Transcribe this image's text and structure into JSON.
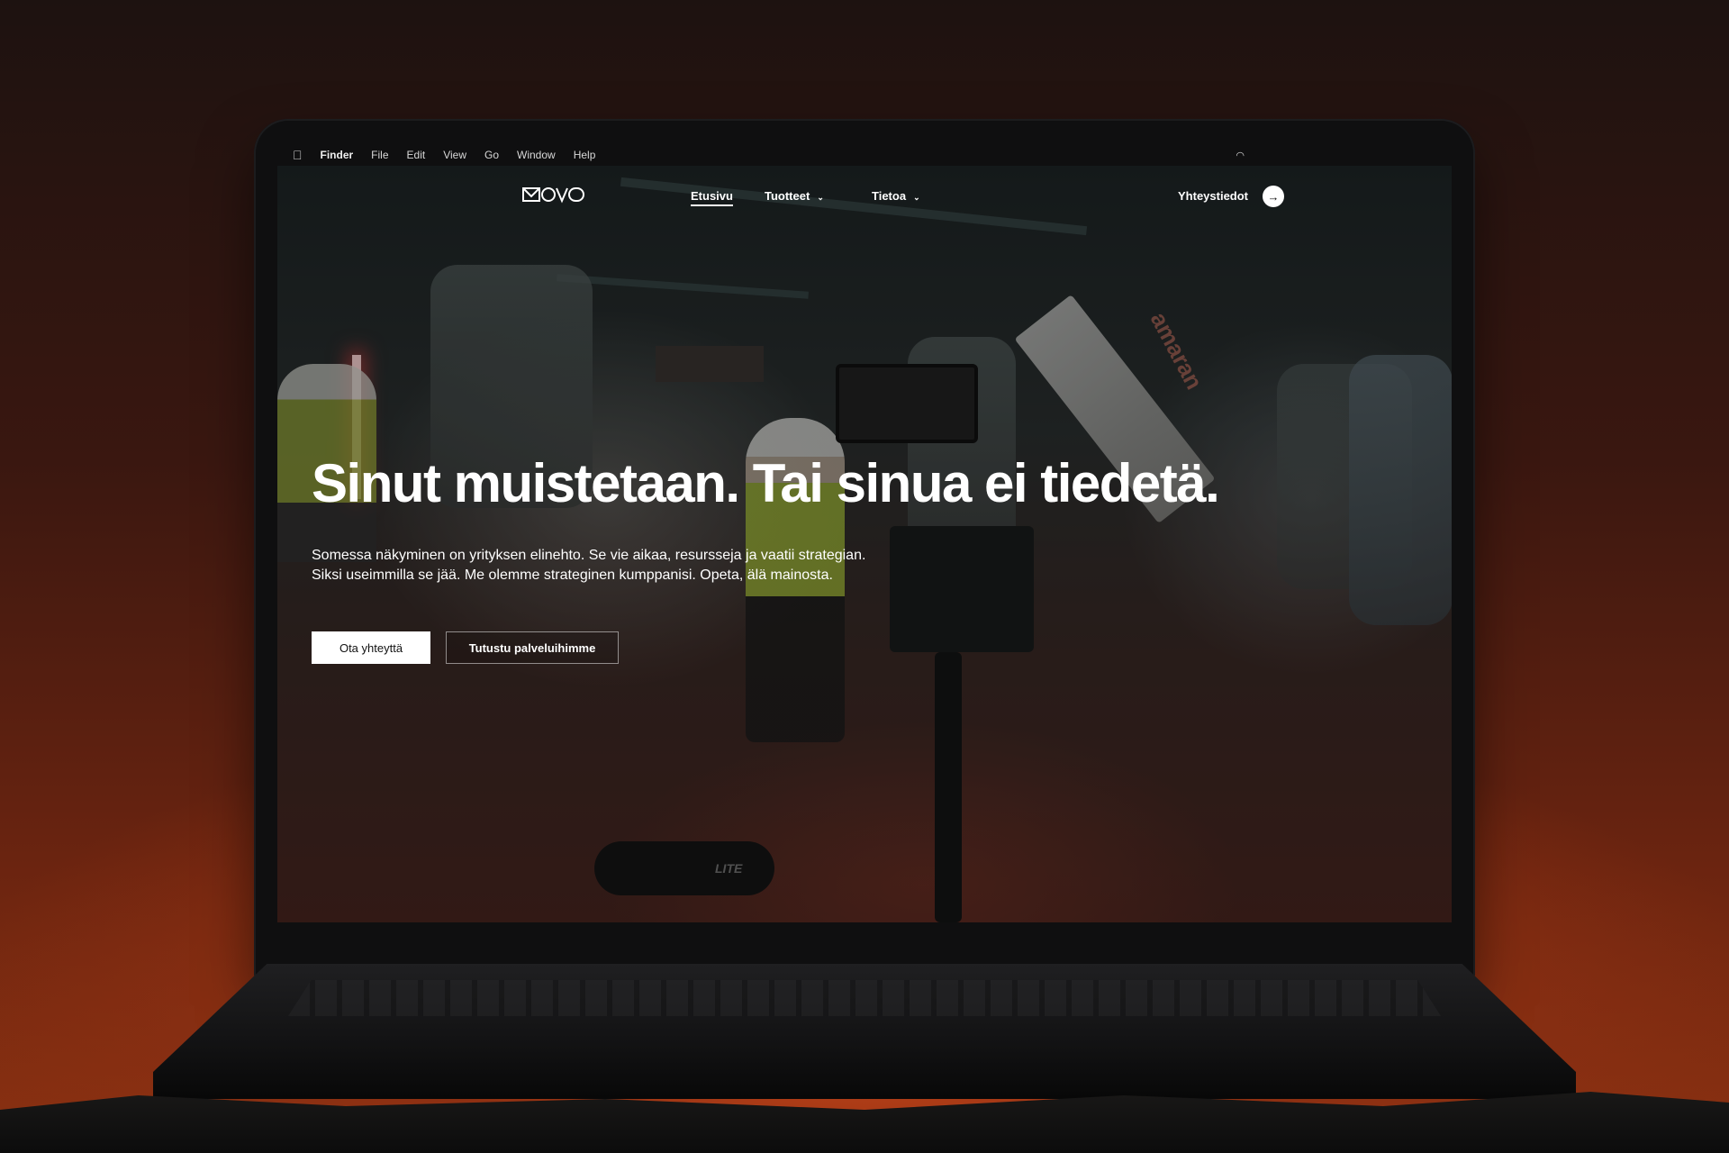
{
  "menubar": {
    "app": "Finder",
    "items": [
      "File",
      "Edit",
      "View",
      "Go",
      "Window",
      "Help"
    ]
  },
  "nav": {
    "links": [
      {
        "label": "Etusivu",
        "active": true
      },
      {
        "label": "Tuotteet",
        "has_dropdown": true
      },
      {
        "label": "Tietoa",
        "has_dropdown": true
      }
    ],
    "contact_label": "Yhteystiedot",
    "contact_icon": "arrow-right-icon"
  },
  "hero": {
    "title": "Sinut muistetaan. Tai sinua ei tiedetä.",
    "subtitle": "Somessa näkyminen on yrityksen elinehto. Se vie aikaa, resursseja ja vaatii strategian. Siksi useimmilla se jää. Me olemme strateginen kumppanisi. Opeta, älä mainosta.",
    "primary_button": "Ota yhteyttä",
    "secondary_button": "Tutustu palveluihimme"
  },
  "background_text": {
    "softbox_brand": "amaran",
    "bag_brand": "LITE"
  },
  "colors": {
    "backdrop": "#8a3111",
    "text": "#ffffff",
    "button_primary_bg": "#ffffff"
  }
}
